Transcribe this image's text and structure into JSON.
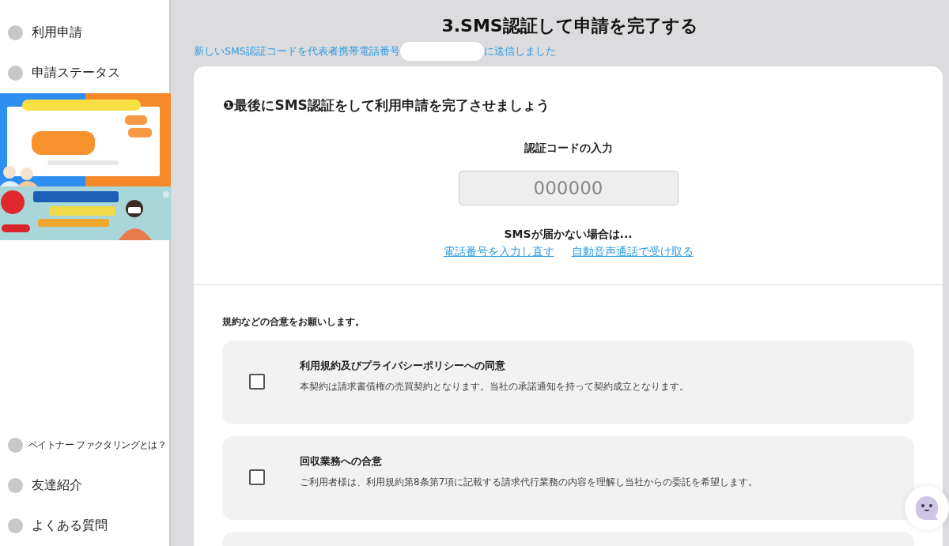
{
  "sidebar": {
    "top_items": [
      {
        "label": "利用申請"
      },
      {
        "label": "申請ステータス"
      }
    ],
    "bottom_items": [
      {
        "label": "ペイトナー ファクタリングとは？"
      },
      {
        "label": "友達紹介"
      },
      {
        "label": "よくある質問"
      }
    ]
  },
  "main": {
    "heading": "3.SMS認証して申請を完了する",
    "notice_before": "新しいSMS認証コードを代表者携帯電話番号",
    "notice_after": "に送信しました",
    "card": {
      "section_title": "❶最後にSMS認証をして利用申請を完了させましょう",
      "code_label": "認証コードの入力",
      "code_field": {
        "placeholder": "000000"
      },
      "no_sms": "SMSが届かない場合は...",
      "links": [
        "電話番号を入力し直す",
        "自動音声通話で受け取る"
      ],
      "agreement_intro": "規約などの合意をお願いします。",
      "agreements": [
        {
          "title": "利用規約及びプライバシーポリシーへの同意",
          "body": "本契約は請求書債権の売買契約となります。当社の承諾通知を持って契約成立となります。",
          "checked": false
        },
        {
          "title": "回収業務への合意",
          "body": "ご利用者様は、利用規約第8条第7項に記載する請求代行業務の内容を理解し当社からの委託を希望します。",
          "checked": false
        }
      ]
    }
  }
}
